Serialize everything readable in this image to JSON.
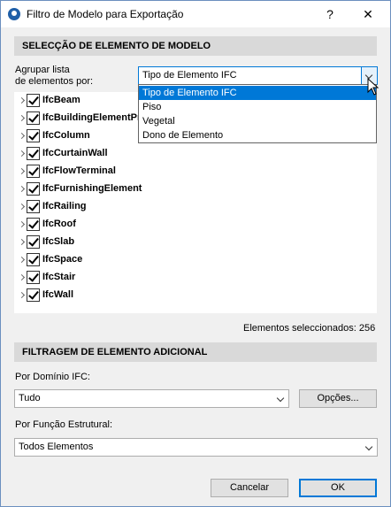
{
  "window": {
    "title": "Filtro de Modelo para Exportação",
    "help_label": "?",
    "close_label": "✕"
  },
  "selection": {
    "header": "SELECÇÃO DE ELEMENTO DE MODELO",
    "group_label_line1": "Agrupar lista",
    "group_label_line2": "de elementos por:",
    "group_value": "Tipo de Elemento IFC",
    "group_options": [
      "Tipo de Elemento IFC",
      "Piso",
      "Vegetal",
      "Dono de Elemento"
    ],
    "tree_items": [
      {
        "label": "IfcBeam",
        "checked": true
      },
      {
        "label": "IfcBuildingElementPr",
        "checked": true
      },
      {
        "label": "IfcColumn",
        "checked": true
      },
      {
        "label": "IfcCurtainWall",
        "checked": true
      },
      {
        "label": "IfcFlowTerminal",
        "checked": true
      },
      {
        "label": "IfcFurnishingElement",
        "checked": true
      },
      {
        "label": "IfcRailing",
        "checked": true
      },
      {
        "label": "IfcRoof",
        "checked": true
      },
      {
        "label": "IfcSlab",
        "checked": true
      },
      {
        "label": "IfcSpace",
        "checked": true
      },
      {
        "label": "IfcStair",
        "checked": true
      },
      {
        "label": "IfcWall",
        "checked": true
      }
    ],
    "selected_count_text": "Elementos seleccionados: 256"
  },
  "filtering": {
    "header": "FILTRAGEM DE ELEMENTO ADICIONAL",
    "domain_label": "Por Domínio IFC:",
    "domain_value": "Tudo",
    "options_button": "Opções...",
    "structural_label": "Por Função Estrutural:",
    "structural_value": "Todos Elementos"
  },
  "footer": {
    "cancel_label": "Cancelar",
    "ok_label": "OK"
  },
  "colors": {
    "accent": "#0078d7",
    "section_header_bg": "#d9d9d9",
    "window_bg": "#f0f0f0"
  }
}
